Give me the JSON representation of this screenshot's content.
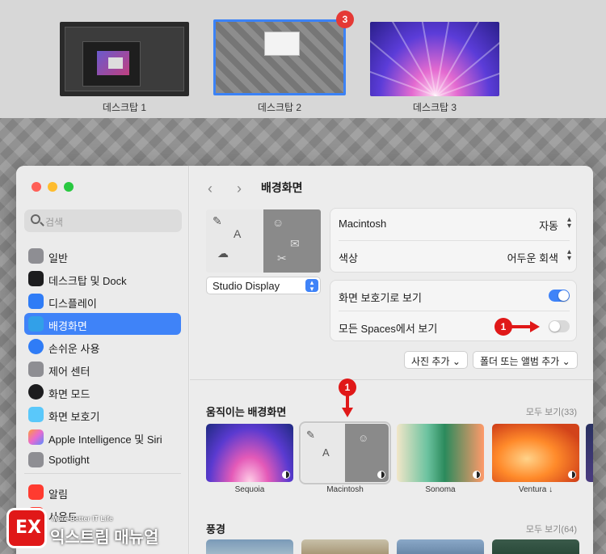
{
  "spaces": {
    "items": [
      {
        "label": "데스크탑 1"
      },
      {
        "label": "데스크탑 2"
      },
      {
        "label": "데스크탑 3"
      }
    ],
    "badge": "3"
  },
  "sidebar": {
    "search_placeholder": "검색",
    "items": [
      {
        "label": "일반",
        "icon": "gear-icon",
        "color": "#8e8e93"
      },
      {
        "label": "데스크탑 및 Dock",
        "icon": "dock-icon",
        "color": "#1c1c1e"
      },
      {
        "label": "디스플레이",
        "icon": "sun-icon",
        "color": "#2f7cf6"
      },
      {
        "label": "배경화면",
        "icon": "wallpaper-icon",
        "color": "#32a0e8"
      },
      {
        "label": "손쉬운 사용",
        "icon": "accessibility-icon",
        "color": "#2f7cf6"
      },
      {
        "label": "제어 센터",
        "icon": "control-center-icon",
        "color": "#8e8e93"
      },
      {
        "label": "화면 모드",
        "icon": "appearance-icon",
        "color": "#1c1c1e"
      },
      {
        "label": "화면 보호기",
        "icon": "screensaver-icon",
        "color": "#5ac8fa"
      },
      {
        "label": "Apple Intelligence 및 Siri",
        "icon": "siri-icon",
        "color": "#e86ad0"
      },
      {
        "label": "Spotlight",
        "icon": "spotlight-icon",
        "color": "#8e8e93"
      },
      {
        "label": "알림",
        "icon": "bell-icon",
        "color": "#ff3b30"
      },
      {
        "label": "사운드",
        "icon": "sound-icon",
        "color": "#ff3b30"
      }
    ]
  },
  "main": {
    "title": "배경화면",
    "display_select": "Studio Display",
    "wallpaper_row": {
      "label": "Macintosh",
      "value": "자동"
    },
    "color_row": {
      "label": "색상",
      "value": "어두운 회색"
    },
    "screensaver_toggle": {
      "label": "화면 보호기로 보기",
      "on": true
    },
    "spaces_toggle": {
      "label": "모든 Spaces에서 보기",
      "on": false
    },
    "add_photo": "사진 추가",
    "add_folder": "폴더 또는 앨범 추가",
    "dynamic_section": {
      "title": "움직이는 배경화면",
      "show_all": "모두 보기(33)",
      "items": [
        {
          "label": "Sequoia"
        },
        {
          "label": "Macintosh"
        },
        {
          "label": "Sonoma"
        },
        {
          "label": "Ventura ↓"
        }
      ]
    },
    "landscape_section": {
      "title": "풍경",
      "show_all": "모두 보기(64)"
    }
  },
  "annotations": {
    "marker_1a": "1",
    "marker_1b": "1"
  },
  "watermark": {
    "mark": "EX",
    "tagline": "More Better IT Life",
    "name": "익스트림 매뉴얼"
  }
}
